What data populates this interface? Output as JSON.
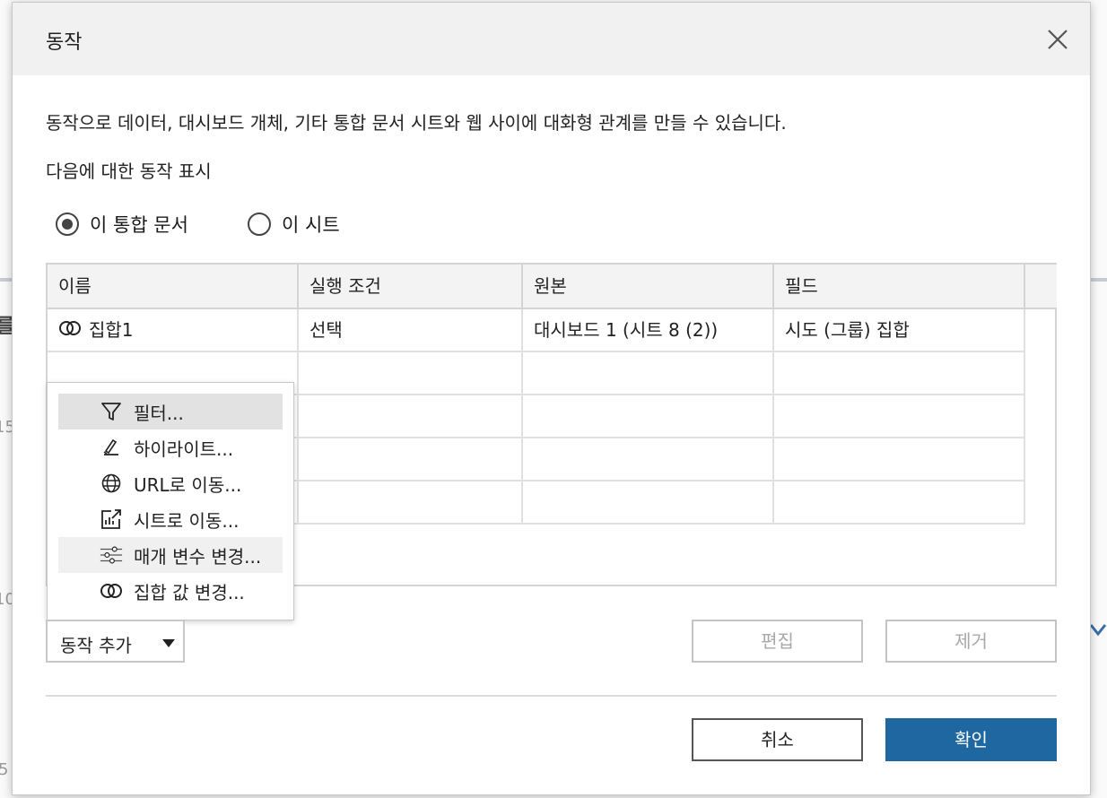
{
  "background": {
    "frag1": "를",
    "frag2": "15",
    "frag3": "10",
    "frag4": "5"
  },
  "dialog": {
    "title": "동작",
    "description": "동작으로 데이터, 대시보드 개체, 기타 통합 문서 시트와 웹 사이에 대화형 관계를 만들 수 있습니다.",
    "show_label": "다음에 대한 동작 표시",
    "radios": [
      {
        "label": "이 통합 문서",
        "selected": true
      },
      {
        "label": "이 시트",
        "selected": false
      }
    ],
    "table": {
      "headers": [
        "이름",
        "실행 조건",
        "원본",
        "필드"
      ],
      "rows": [
        {
          "name": "집합1",
          "icon": "set-icon",
          "trigger": "선택",
          "source": "대시보드 1 (시트 8 (2))",
          "field": "시도 (그룹) 집합"
        }
      ]
    },
    "menu": {
      "items": [
        {
          "label": "필터...",
          "icon": "filter-icon",
          "highlight": "hover"
        },
        {
          "label": "하이라이트...",
          "icon": "highlight-pen-icon"
        },
        {
          "label": "URL로 이동...",
          "icon": "globe-icon"
        },
        {
          "label": "시트로 이동...",
          "icon": "go-to-sheet-icon"
        },
        {
          "label": "매개 변수 변경...",
          "icon": "sliders-icon",
          "highlight": "light"
        },
        {
          "label": "집합 값 변경...",
          "icon": "set-icon"
        }
      ]
    },
    "add_action_label": "동작 추가",
    "edit_label": "편집",
    "remove_label": "제거",
    "cancel_label": "취소",
    "ok_label": "확인",
    "colors": {
      "primary": "#1f67a0",
      "menu_hover": "#e2e2e2"
    }
  }
}
